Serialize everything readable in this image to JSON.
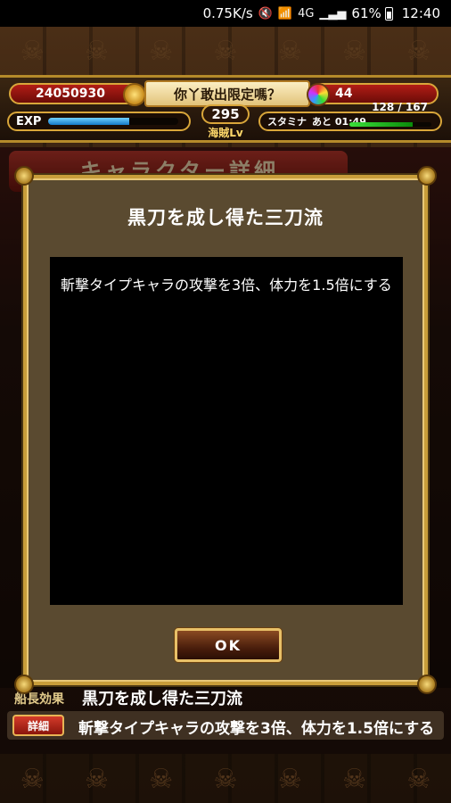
{
  "status_bar": {
    "speed": "0.75K/s",
    "battery_percent": "61%",
    "time": "12:40",
    "signal_label": "4G",
    "icons": [
      "mute-icon",
      "wifi-icon",
      "data-icon",
      "signal-icon",
      "battery-icon"
    ]
  },
  "header": {
    "berry_count": "24050930",
    "banner_text": "你丫敢出限定嗎？",
    "gem_count": "44",
    "exp_label": "EXP",
    "exp_fill_percent": 62,
    "level": "295",
    "level_label": "海賊Lv",
    "stamina_label": "スタミナ",
    "stamina_timer": "あと 01:49",
    "stamina_count": "128 / 167",
    "stamina_fill_percent": 77
  },
  "background_screen": {
    "title": "キャラクター詳細",
    "leader_skill_label": "船長効果",
    "leader_skill_name": "黒刀を成し得た三刀流",
    "detail_button": "詳細",
    "leader_skill_desc": "斬撃タイプキャラの攻撃を3倍、体力を1.5倍にする"
  },
  "modal": {
    "title": "黒刀を成し得た三刀流",
    "body_text": "斬撃タイプキャラの攻撃を3倍、体力を1.5倍にする",
    "ok_label": "OK"
  },
  "colors": {
    "frame_gold": "#c89d3a",
    "modal_bg": "#5a4a30",
    "pill_red": "#b21d16"
  }
}
